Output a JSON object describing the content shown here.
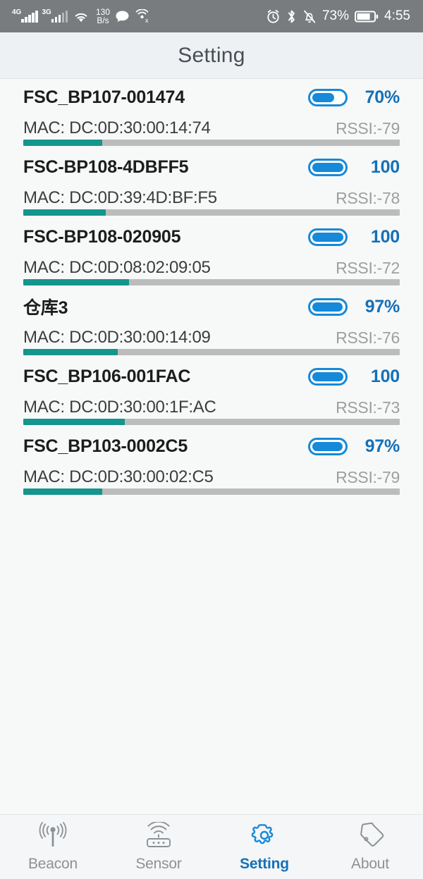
{
  "statusbar": {
    "network_primary": "4G",
    "network_secondary": "3G",
    "wifi_icon": "wifi-icon",
    "data_rate_value": "130",
    "data_rate_unit": "B/s",
    "message_icon": "chat-bubble-icon",
    "hotspot_off_icon": "hotspot-disabled-icon",
    "alarm_icon": "alarm-clock-icon",
    "bluetooth_icon": "bluetooth-icon",
    "silent_icon": "bell-muted-icon",
    "battery_percent": "73%",
    "battery_icon": "battery-icon",
    "time": "4:55"
  },
  "header": {
    "title": "Setting"
  },
  "colors": {
    "accent_blue": "#1689d8",
    "value_blue": "#1570b8",
    "progress_teal": "#14958d",
    "progress_track": "#bcbcbc",
    "statusbar_bg": "#787c7e",
    "titlebar_bg": "#eef1f3",
    "page_bg": "#f7f9f9"
  },
  "devices": [
    {
      "name": "FSC_BP107-001474",
      "mac": "MAC: DC:0D:30:00:14:74",
      "battery_label": "70%",
      "battery_fill_pct": 70,
      "rssi": "RSSI:-79",
      "progress_pct": 21
    },
    {
      "name": "FSC-BP108-4DBFF5",
      "mac": "MAC: DC:0D:39:4D:BF:F5",
      "battery_label": "100",
      "battery_fill_pct": 100,
      "rssi": "RSSI:-78",
      "progress_pct": 22
    },
    {
      "name": "FSC-BP108-020905",
      "mac": "MAC: DC:0D:08:02:09:05",
      "battery_label": "100",
      "battery_fill_pct": 100,
      "rssi": "RSSI:-72",
      "progress_pct": 28
    },
    {
      "name": "仓库3",
      "mac": "MAC: DC:0D:30:00:14:09",
      "battery_label": "97%",
      "battery_fill_pct": 97,
      "rssi": "RSSI:-76",
      "progress_pct": 25
    },
    {
      "name": "FSC_BP106-001FAC",
      "mac": "MAC: DC:0D:30:00:1F:AC",
      "battery_label": "100",
      "battery_fill_pct": 100,
      "rssi": "RSSI:-73",
      "progress_pct": 27
    },
    {
      "name": "FSC_BP103-0002C5",
      "mac": "MAC: DC:0D:30:00:02:C5",
      "battery_label": "97%",
      "battery_fill_pct": 97,
      "rssi": "RSSI:-79",
      "progress_pct": 21
    }
  ],
  "tabs": [
    {
      "label": "Beacon",
      "icon": "beacon-antenna-icon",
      "active": false
    },
    {
      "label": "Sensor",
      "icon": "sensor-router-icon",
      "active": false
    },
    {
      "label": "Setting",
      "icon": "gear-icon",
      "active": true
    },
    {
      "label": "About",
      "icon": "tag-icon",
      "active": false
    }
  ]
}
